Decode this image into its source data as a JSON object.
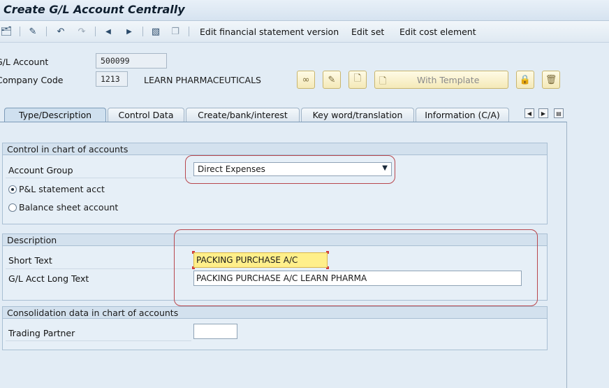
{
  "window": {
    "title": "Create G/L Account Centrally"
  },
  "toolbar": {
    "icons": [
      "other-object-icon",
      "display-change-icon",
      "undo-icon",
      "redo-icon",
      "previous-icon",
      "next-icon",
      "financial-statement-icon",
      "copy-icon"
    ],
    "edit_fsv_label": "Edit financial statement version",
    "edit_set_label": "Edit set",
    "edit_cost_element_label": "Edit cost element"
  },
  "header": {
    "gl_account_label": "G/L Account",
    "gl_account_value": "500099",
    "company_code_label": "Company Code",
    "company_code_value": "1213",
    "company_name": "LEARN PHARMACEUTICALS",
    "buttons": {
      "display_icon": "glasses-icon",
      "change_icon": "pencil-icon",
      "create_icon": "document-icon",
      "with_template_label": "With Template",
      "lock_icon": "lock-icon",
      "delete_icon": "trash-icon"
    }
  },
  "tabs": [
    {
      "label": "Type/Description",
      "active": true
    },
    {
      "label": "Control Data",
      "active": false
    },
    {
      "label": "Create/bank/interest",
      "active": false
    },
    {
      "label": "Key word/translation",
      "active": false
    },
    {
      "label": "Information (C/A)",
      "active": false
    }
  ],
  "control_group": {
    "title": "Control in chart of accounts",
    "account_group_label": "Account Group",
    "account_group_value": "Direct Expenses",
    "pl_label": "P&L statement acct",
    "bs_label": "Balance sheet account",
    "selected": "pl"
  },
  "description_group": {
    "title": "Description",
    "short_text_label": "Short Text",
    "short_text_value": "PACKING PURCHASE A/C",
    "long_text_label": "G/L Acct Long Text",
    "long_text_value": "PACKING PURCHASE A/C LEARN PHARMA"
  },
  "consolidation_group": {
    "title": "Consolidation data in chart of accounts",
    "trading_partner_label": "Trading Partner",
    "trading_partner_value": ""
  },
  "colors": {
    "highlight_outline": "#b8474e",
    "focus_field": "#ffef8a",
    "button_bg": "#f4e9b8"
  }
}
